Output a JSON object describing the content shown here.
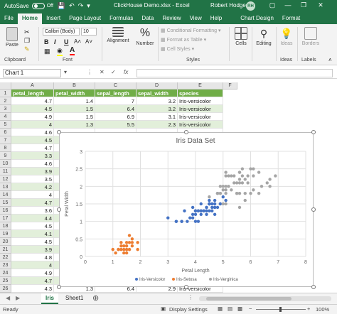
{
  "titlebar": {
    "autosave_label": "AutoSave",
    "autosave_state": "Off",
    "doc_title": "ClickHouse Demo.xlsx  -  Excel",
    "user_name": "Robert Hodges",
    "user_initials": "RH",
    "minimize": "—",
    "restore": "❐",
    "close": "✕"
  },
  "tabs": [
    "File",
    "Home",
    "Insert",
    "Page Layout",
    "Formulas",
    "Data",
    "Review",
    "View",
    "Help",
    "Chart Design",
    "Format"
  ],
  "active_tab": "Home",
  "ribbon": {
    "paste_label": "Paste",
    "clipboard_label": "Clipboard",
    "font_name": "Calibri (Body)",
    "font_size": "10",
    "bold": "B",
    "italic": "I",
    "underline": "U",
    "font_label": "Font",
    "alignment_label": "Alignment",
    "number_label": "Number",
    "cond_format_label": "Conditional Formatting",
    "format_table_label": "Format as Table",
    "cell_styles_label": "Cell Styles",
    "styles_label": "Styles",
    "cells_label": "Cells",
    "editing_label": "Editing",
    "ideas_label": "Ideas",
    "ideas_group_label": "Ideas",
    "borders_label": "Borders",
    "borders_group_label": "Labels",
    "accent": "#217346"
  },
  "formula_bar": {
    "name_box": "Chart 1",
    "fx": "fx",
    "value": ""
  },
  "columns": [
    "A",
    "B",
    "C",
    "D",
    "E",
    "F"
  ],
  "header_row": [
    "petal_length",
    "petal_width",
    "sepal_length",
    "sepal_width",
    "species"
  ],
  "rows": [
    {
      "n": "2",
      "a": "4.7",
      "b": "1.4",
      "c": "7",
      "d": "3.2",
      "e": "Iris-versicolor"
    },
    {
      "n": "3",
      "a": "4.5",
      "b": "1.5",
      "c": "6.4",
      "d": "3.2",
      "e": "Iris-versicolor"
    },
    {
      "n": "4",
      "a": "4.9",
      "b": "1.5",
      "c": "6.9",
      "d": "3.1",
      "e": "Iris-versicolor"
    },
    {
      "n": "5",
      "a": "4",
      "b": "1.3",
      "c": "5.5",
      "d": "2.3",
      "e": "Iris-versicolor"
    },
    {
      "n": "6",
      "a": "4.6"
    },
    {
      "n": "7",
      "a": "4.5"
    },
    {
      "n": "8",
      "a": "4.7"
    },
    {
      "n": "9",
      "a": "3.3"
    },
    {
      "n": "10",
      "a": "4.6"
    },
    {
      "n": "11",
      "a": "3.9"
    },
    {
      "n": "12",
      "a": "3.5"
    },
    {
      "n": "13",
      "a": "4.2"
    },
    {
      "n": "14",
      "a": "4"
    },
    {
      "n": "15",
      "a": "4.7"
    },
    {
      "n": "16",
      "a": "3.6"
    },
    {
      "n": "17",
      "a": "4.4"
    },
    {
      "n": "18",
      "a": "4.5"
    },
    {
      "n": "19",
      "a": "4.1"
    },
    {
      "n": "20",
      "a": "4.5"
    },
    {
      "n": "21",
      "a": "3.9"
    },
    {
      "n": "22",
      "a": "4.8"
    },
    {
      "n": "23",
      "a": "4"
    },
    {
      "n": "24",
      "a": "4.9"
    },
    {
      "n": "25",
      "a": "4.7"
    },
    {
      "n": "26",
      "a": "4.3",
      "b": "1.3",
      "c": "6.4",
      "d": "2.9",
      "e": "Iris-versicolor"
    }
  ],
  "sheets": [
    "Iris",
    "Sheet1"
  ],
  "active_sheet": "Iris",
  "status": {
    "ready": "Ready",
    "display_settings": "Display Settings",
    "zoom": "100%"
  },
  "chart_data": {
    "type": "scatter",
    "title": "Iris Data Set",
    "xlabel": "Petal Length",
    "ylabel": "Petal Width",
    "xlim": [
      0,
      8
    ],
    "ylim": [
      0,
      3
    ],
    "xticks": [
      "0",
      "1",
      "2",
      "3",
      "4",
      "5",
      "6",
      "7",
      "8"
    ],
    "yticks": [
      "0",
      "0.5",
      "1",
      "1.5",
      "2",
      "2.5",
      "3"
    ],
    "grid": true,
    "legend_position": "bottom",
    "series": [
      {
        "name": "Iris-Versicolor",
        "color": "#4472c4",
        "points": [
          [
            4.7,
            1.4
          ],
          [
            4.5,
            1.5
          ],
          [
            4.9,
            1.5
          ],
          [
            4.0,
            1.3
          ],
          [
            4.6,
            1.5
          ],
          [
            4.5,
            1.3
          ],
          [
            4.7,
            1.6
          ],
          [
            3.3,
            1.0
          ],
          [
            4.6,
            1.3
          ],
          [
            3.9,
            1.4
          ],
          [
            3.5,
            1.0
          ],
          [
            4.2,
            1.5
          ],
          [
            4.0,
            1.0
          ],
          [
            4.7,
            1.4
          ],
          [
            3.6,
            1.3
          ],
          [
            4.4,
            1.4
          ],
          [
            4.5,
            1.5
          ],
          [
            4.1,
            1.0
          ],
          [
            4.5,
            1.5
          ],
          [
            3.9,
            1.1
          ],
          [
            4.8,
            1.8
          ],
          [
            4.0,
            1.3
          ],
          [
            4.9,
            1.5
          ],
          [
            4.7,
            1.2
          ],
          [
            4.3,
            1.3
          ],
          [
            4.4,
            1.4
          ],
          [
            4.8,
            1.4
          ],
          [
            5.0,
            1.7
          ],
          [
            4.5,
            1.5
          ],
          [
            3.5,
            1.0
          ],
          [
            3.8,
            1.1
          ],
          [
            3.7,
            1.0
          ],
          [
            3.9,
            1.2
          ],
          [
            5.1,
            1.6
          ],
          [
            4.5,
            1.5
          ],
          [
            4.5,
            1.6
          ],
          [
            4.7,
            1.5
          ],
          [
            4.4,
            1.3
          ],
          [
            4.1,
            1.3
          ],
          [
            4.0,
            1.3
          ],
          [
            4.4,
            1.2
          ],
          [
            4.6,
            1.4
          ],
          [
            4.0,
            1.2
          ],
          [
            3.3,
            1.0
          ],
          [
            4.2,
            1.3
          ],
          [
            4.2,
            1.2
          ],
          [
            4.2,
            1.3
          ],
          [
            4.3,
            1.3
          ],
          [
            3.0,
            1.1
          ],
          [
            4.1,
            1.3
          ]
        ]
      },
      {
        "name": "Iris-Setosa",
        "color": "#ed7d31",
        "points": [
          [
            1.4,
            0.2
          ],
          [
            1.3,
            0.2
          ],
          [
            1.5,
            0.2
          ],
          [
            1.7,
            0.4
          ],
          [
            1.4,
            0.3
          ],
          [
            1.5,
            0.1
          ],
          [
            1.6,
            0.2
          ],
          [
            1.1,
            0.1
          ],
          [
            1.2,
            0.2
          ],
          [
            1.3,
            0.4
          ],
          [
            1.7,
            0.3
          ],
          [
            1.5,
            0.3
          ],
          [
            1.0,
            0.2
          ],
          [
            1.7,
            0.5
          ],
          [
            1.9,
            0.2
          ],
          [
            1.6,
            0.4
          ],
          [
            1.5,
            0.4
          ],
          [
            1.9,
            0.4
          ],
          [
            1.6,
            0.6
          ],
          [
            1.4,
            0.1
          ],
          [
            1.2,
            0.2
          ],
          [
            1.6,
            0.2
          ],
          [
            1.3,
            0.3
          ],
          [
            1.5,
            0.2
          ]
        ]
      },
      {
        "name": "Iris-Verginica",
        "color": "#a5a5a5",
        "points": [
          [
            6.0,
            2.5
          ],
          [
            5.1,
            1.9
          ],
          [
            5.9,
            2.1
          ],
          [
            5.6,
            1.8
          ],
          [
            5.8,
            2.2
          ],
          [
            6.6,
            2.1
          ],
          [
            4.5,
            1.7
          ],
          [
            6.3,
            1.8
          ],
          [
            5.8,
            1.8
          ],
          [
            6.1,
            2.5
          ],
          [
            5.1,
            2.0
          ],
          [
            5.3,
            1.9
          ],
          [
            5.5,
            2.1
          ],
          [
            5.0,
            2.0
          ],
          [
            5.1,
            2.4
          ],
          [
            5.3,
            2.3
          ],
          [
            5.5,
            1.8
          ],
          [
            6.7,
            2.2
          ],
          [
            6.9,
            2.3
          ],
          [
            5.0,
            1.5
          ],
          [
            5.7,
            2.3
          ],
          [
            4.9,
            2.0
          ],
          [
            6.7,
            2.0
          ],
          [
            4.9,
            1.8
          ],
          [
            5.7,
            2.1
          ],
          [
            6.0,
            1.8
          ],
          [
            4.8,
            1.8
          ],
          [
            4.9,
            1.8
          ],
          [
            5.6,
            2.1
          ],
          [
            5.8,
            1.6
          ],
          [
            6.1,
            1.9
          ],
          [
            6.4,
            2.0
          ],
          [
            5.6,
            2.2
          ],
          [
            5.1,
            1.5
          ],
          [
            5.6,
            1.4
          ],
          [
            6.1,
            2.3
          ],
          [
            5.6,
            2.4
          ],
          [
            5.5,
            1.8
          ],
          [
            4.8,
            1.8
          ],
          [
            5.4,
            2.1
          ],
          [
            5.6,
            2.4
          ],
          [
            5.1,
            2.3
          ],
          [
            5.9,
            2.3
          ],
          [
            5.7,
            2.5
          ],
          [
            5.2,
            2.3
          ],
          [
            5.0,
            1.9
          ],
          [
            5.2,
            2.0
          ],
          [
            5.4,
            2.3
          ],
          [
            5.1,
            1.8
          ],
          [
            6.3,
            2.4
          ]
        ]
      }
    ]
  }
}
